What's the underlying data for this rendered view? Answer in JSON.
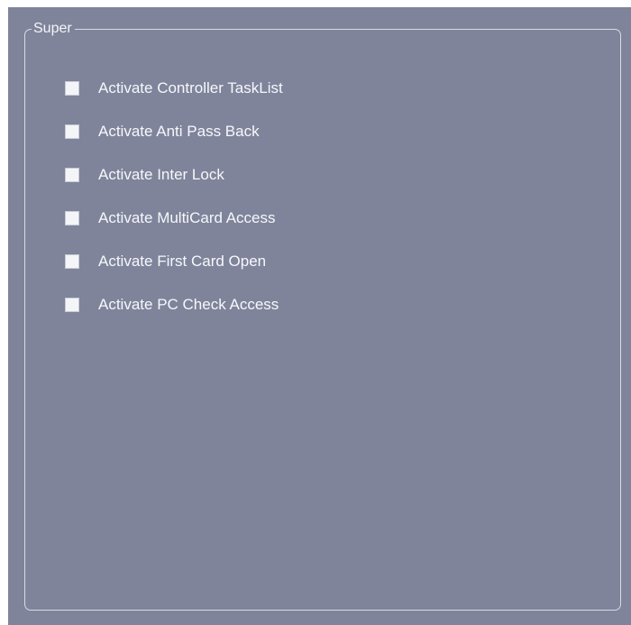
{
  "group": {
    "title": "Super"
  },
  "options": [
    {
      "label": "Activate Controller TaskList",
      "checked": false
    },
    {
      "label": "Activate Anti Pass Back",
      "checked": false
    },
    {
      "label": "Activate Inter Lock",
      "checked": false
    },
    {
      "label": "Activate MultiCard Access",
      "checked": false
    },
    {
      "label": "Activate First Card Open",
      "checked": false
    },
    {
      "label": "Activate PC Check Access",
      "checked": false
    }
  ],
  "colors": {
    "panel_background": "#7f849b",
    "group_border": "#d9dbe4",
    "checkbox_fill": "#f4f5f7",
    "text": "#f7f8fb"
  }
}
